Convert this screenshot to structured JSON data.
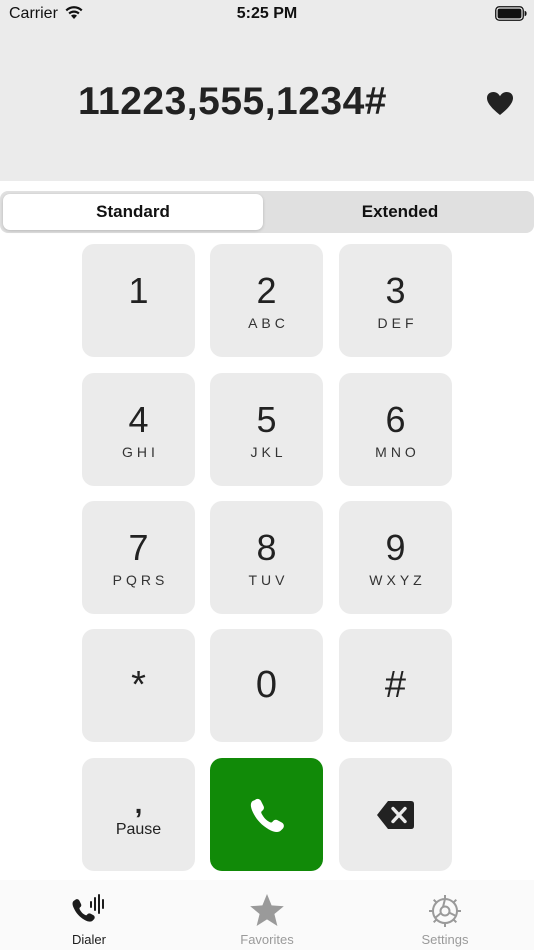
{
  "status_bar": {
    "carrier": "Carrier",
    "time": "5:25 PM",
    "wifi_icon": "wifi-icon",
    "battery_icon": "battery-icon"
  },
  "display": {
    "number": "11223,555,1234#",
    "favorite_icon": "heart-icon"
  },
  "segments": [
    {
      "label": "Standard",
      "selected": true
    },
    {
      "label": "Extended",
      "selected": false
    }
  ],
  "keypad": {
    "keys": [
      {
        "digit": "1",
        "letters": ""
      },
      {
        "digit": "2",
        "letters": "ABC"
      },
      {
        "digit": "3",
        "letters": "DEF"
      },
      {
        "digit": "4",
        "letters": "GHI"
      },
      {
        "digit": "5",
        "letters": "JKL"
      },
      {
        "digit": "6",
        "letters": "MNO"
      },
      {
        "digit": "7",
        "letters": "PQRS"
      },
      {
        "digit": "8",
        "letters": "TUV"
      },
      {
        "digit": "9",
        "letters": "WXYZ"
      },
      {
        "digit": "*",
        "letters": ""
      },
      {
        "digit": "0",
        "letters": ""
      },
      {
        "digit": "#",
        "letters": ""
      }
    ],
    "pause": {
      "symbol": ",",
      "label": "Pause"
    },
    "call_icon": "phone-icon",
    "delete_icon": "backspace-icon"
  },
  "tabs": [
    {
      "label": "Dialer",
      "icon": "dialer-icon",
      "active": true
    },
    {
      "label": "Favorites",
      "icon": "star-icon",
      "active": false
    },
    {
      "label": "Settings",
      "icon": "gear-icon",
      "active": false
    }
  ],
  "colors": {
    "call_green": "#118a08",
    "key_background": "#ebebeb",
    "inactive_tab": "#9a9a9a"
  }
}
